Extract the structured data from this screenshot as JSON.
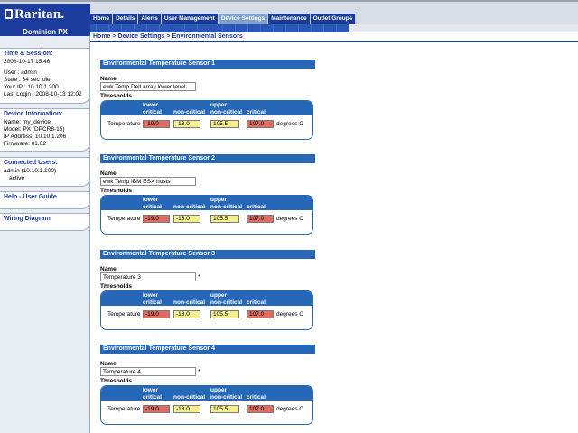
{
  "brand": {
    "logo": "Raritan.",
    "product": "Dominion PX"
  },
  "tabs": [
    "Home",
    "Details",
    "Alerts",
    "User Management",
    "Device Settings",
    "Maintenance",
    "Outlet Groups"
  ],
  "active_tab": "Device Settings",
  "breadcrumb": "Home > Device Settings > Environmental Sensors",
  "sidebar": {
    "time_session": {
      "title": "Time & Session:",
      "datetime": "2008-10-17 15:46",
      "user": "User : admin",
      "state": "State : 34 sec idle",
      "ip": "Your IP : 10.10.1.200",
      "last_login": "Last Login : 2008-10-13 12:02"
    },
    "device_info": {
      "title": "Device Information:",
      "name": "Name: my_device",
      "model": "Model: PX (DPCR8-15)",
      "ip": "IP Address: 10.10.1.206",
      "firmware": "Firmware: 01.02"
    },
    "connected_users": {
      "title": "Connected Users:",
      "user": "admin (10.10.1.200)",
      "status": "active"
    },
    "help_link": "Help - User Guide",
    "wiring_link": "Wiring Diagram"
  },
  "labels": {
    "name": "Name",
    "thresholds": "Thresholds",
    "lower": "lower",
    "upper": "upper",
    "critical": "critical",
    "non_critical": "non-critical",
    "row": "Temperature",
    "units": "degrees C"
  },
  "sensors": [
    {
      "title": "Environmental Temperature Sensor 1",
      "name": "ewk Temp Dell array lower level",
      "required": "",
      "lower_critical": "-19.0",
      "lower_noncritical": "-18.0",
      "upper_noncritical": "105.5",
      "upper_critical": "107.0"
    },
    {
      "title": "Environmental Temperature Sensor 2",
      "name": "ewk Temp IBM ESX hosts",
      "required": "",
      "lower_critical": "-19.0",
      "lower_noncritical": "-18.0",
      "upper_noncritical": "105.5",
      "upper_critical": "107.0"
    },
    {
      "title": "Environmental Temperature Sensor 3",
      "name": "Temperature 3",
      "required": "*",
      "lower_critical": "-19.0",
      "lower_noncritical": "-18.0",
      "upper_noncritical": "105.5",
      "upper_critical": "107.0"
    },
    {
      "title": "Environmental Temperature Sensor 4",
      "name": "Temperature 4",
      "required": "*",
      "lower_critical": "-19.0",
      "lower_noncritical": "-18.0",
      "upper_noncritical": "105.5",
      "upper_critical": "107.0"
    }
  ],
  "colors": {
    "brand_blue": "#1c3c9e",
    "section_blue": "#2767b8",
    "critical": "#e06b5e",
    "non_critical": "#f6ef8d"
  }
}
